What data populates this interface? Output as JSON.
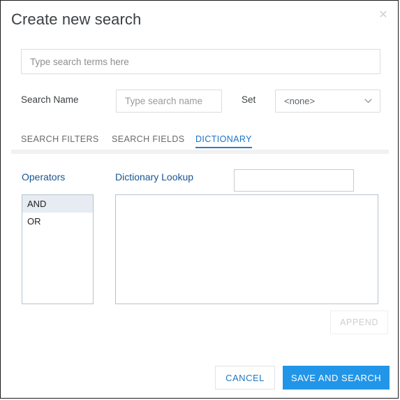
{
  "dialog": {
    "title": "Create new search",
    "close_icon": "close-icon"
  },
  "search_terms": {
    "value": "",
    "placeholder": "Type search terms here"
  },
  "search_name": {
    "label": "Search Name",
    "value": "",
    "placeholder": "Type search name"
  },
  "set": {
    "label": "Set",
    "selected": "<none>",
    "chevron_icon": "chevron-down-icon",
    "options": [
      "<none>"
    ]
  },
  "tabs": [
    {
      "label": "SEARCH FILTERS",
      "active": false
    },
    {
      "label": "SEARCH FIELDS",
      "active": false
    },
    {
      "label": "DICTIONARY",
      "active": true
    }
  ],
  "dictionary_panel": {
    "operators_label": "Operators",
    "operators": [
      {
        "label": "AND",
        "selected": true
      },
      {
        "label": "OR",
        "selected": false
      }
    ],
    "lookup_label": "Dictionary Lookup",
    "lookup_value": "",
    "lookup_placeholder": "",
    "textarea_value": "",
    "textarea_placeholder": "",
    "append_label": "APPEND",
    "append_disabled": true
  },
  "footer": {
    "cancel_label": "CANCEL",
    "save_label": "SAVE AND SEARCH"
  },
  "colors": {
    "accent_blue": "#2196e8",
    "label_blue": "#1a5490",
    "tab_active_blue": "#1a73c7",
    "selected_row": "#e6ecf2"
  }
}
